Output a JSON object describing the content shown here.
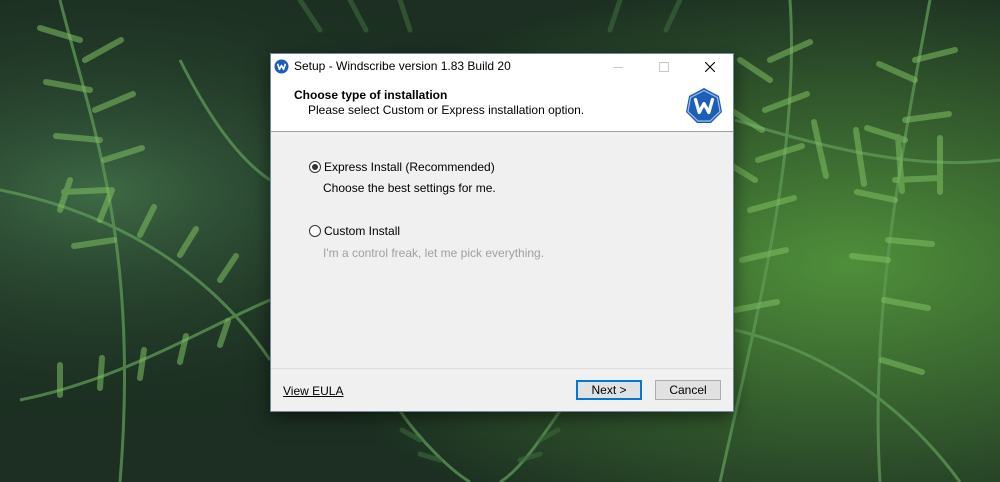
{
  "window": {
    "title": "Setup - Windscribe version 1.83 Build 20"
  },
  "header": {
    "title": "Choose type of installation",
    "subtitle": "Please select Custom or Express installation option."
  },
  "options": {
    "express": {
      "label": "Express Install (Recommended)",
      "description": "Choose the best settings for me.",
      "selected": true
    },
    "custom": {
      "label": "Custom Install",
      "description": "I'm a control freak, let me pick everything.",
      "selected": false
    }
  },
  "footer": {
    "eula_label": "View EULA",
    "next_label": "Next >",
    "cancel_label": "Cancel"
  },
  "colors": {
    "accent": "#0078d7",
    "logo_blue": "#1b5fb8",
    "disabled_text": "#a0a0a0"
  },
  "icons": {
    "app": "windscribe-w-icon",
    "minimize": "minimize-icon",
    "maximize": "maximize-icon",
    "close": "close-icon"
  }
}
